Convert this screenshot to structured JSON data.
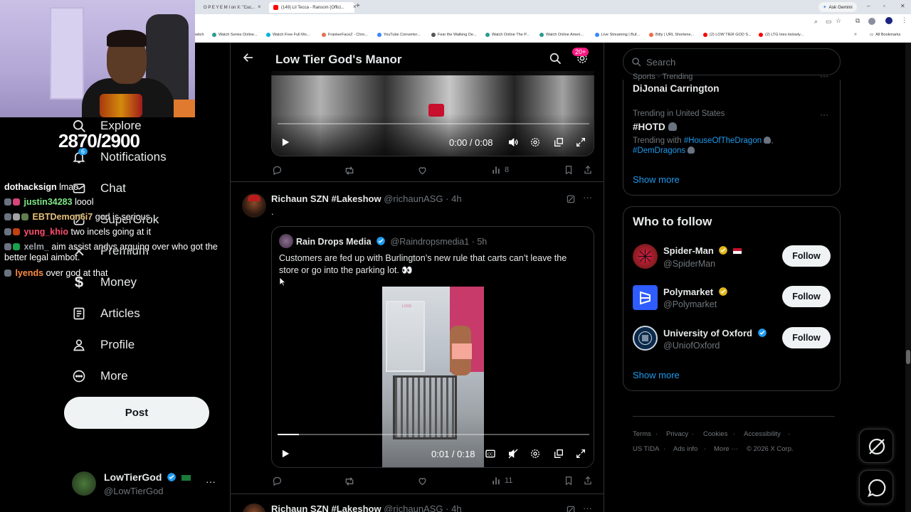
{
  "browser": {
    "tabs": [
      {
        "label": "(149) Lil Tecca - Ransom (Offici...",
        "favicon_color": "#ff0000"
      },
      {
        "label": "O P E Y E M I on X: \"Cuc...",
        "favicon_color": "#111111"
      }
    ],
    "ask_gemini": "Ask Gemini",
    "bookmarks": [
      "Watch Series Online...",
      "Watch Free Full Mo...",
      "FrankerFaceZ - Chro...",
      "YouTube Converter...",
      "Fear the Walking De...",
      "Watch Online The P...",
      "Watch Online Ameri...",
      "Live Streaming | Buf...",
      "Bitly | URL Shortene...",
      "(2) LOW TIER GOD S...",
      "(2) LTG tries itslowly..."
    ],
    "all_bookmarks": "All Bookmarks"
  },
  "stream": {
    "counter": "2870/2900",
    "chat": [
      {
        "user": "dothacksign",
        "user_color": "#ffffff",
        "message": "lmao"
      },
      {
        "user": "justin34283",
        "user_color": "#7ee787",
        "message": "loool"
      },
      {
        "user": "EBTDemon6i7",
        "user_color": "#e5c07b",
        "message": "god is serious"
      },
      {
        "user": "yung_khio",
        "user_color": "#ff4d6d",
        "message": "two incels going at it"
      },
      {
        "user": "xelm_",
        "user_color": "#9aa0a6",
        "message": "aim assist andys arguing over who got the better legal aimbot."
      },
      {
        "user": "lyends",
        "user_color": "#ff8c42",
        "message": "over god at that"
      }
    ]
  },
  "nav": {
    "items": [
      {
        "label": "Explore",
        "icon": "search-icon"
      },
      {
        "label": "Notifications",
        "icon": "bell-icon",
        "badge": "6"
      },
      {
        "label": "Chat",
        "icon": "envelope-icon"
      },
      {
        "label": "SuperGrok",
        "icon": "grok-icon"
      },
      {
        "label": "Premium",
        "icon": "x-icon"
      },
      {
        "label": "Money",
        "icon": "dollar-icon"
      },
      {
        "label": "Articles",
        "icon": "article-icon"
      },
      {
        "label": "Profile",
        "icon": "person-icon"
      },
      {
        "label": "More",
        "icon": "more-circle-icon"
      }
    ],
    "post_label": "Post",
    "account": {
      "name": "LowTierGod",
      "handle": "@LowTierGod"
    }
  },
  "main": {
    "title": "Low Tier God's Manor",
    "notif_badge": "20+",
    "first_video": {
      "time": "0:00 / 0:08",
      "views": "8"
    },
    "tweet": {
      "author": "Richaun SZN #Lakeshow",
      "handle": "@richaunASG",
      "time": "4h",
      "text": ".",
      "quoted": {
        "author": "Rain Drops Media",
        "handle": "@Raindropsmedia1",
        "time": "5h",
        "text": "Customers are fed up with Burlington’s new rule that carts can’t leave the store or go into the parking lot. 👀",
        "video_time": "0:01 / 0:18",
        "store_sign": "LOVE"
      },
      "views": "11"
    },
    "next_tweet": {
      "author": "Richaun SZN #Lakeshow",
      "handle": "@richaunASG",
      "time": "4h"
    }
  },
  "right": {
    "search_placeholder": "Search",
    "trends": [
      {
        "context": "Sports · Trending",
        "name": "DiJonai Carrington"
      },
      {
        "context": "Trending in United States",
        "name": "#HOTD",
        "trending_with_label": "Trending with",
        "trending_with": [
          "#HouseOfTheDragon",
          "#DemDragons"
        ]
      }
    ],
    "show_more": "Show more",
    "who_to_follow_title": "Who to follow",
    "follow_suggestions": [
      {
        "name": "Spider-Man",
        "handle": "@SpiderMan",
        "avatar_color": "#c8102e",
        "follow_label": "Follow"
      },
      {
        "name": "Polymarket",
        "handle": "@Polymarket",
        "avatar_color": "#2e5cff",
        "follow_label": "Follow"
      },
      {
        "name": "University of Oxford",
        "handle": "@UniofOxford",
        "avatar_color": "#0b2a4a",
        "follow_label": "Follow"
      }
    ],
    "footer": [
      "Terms",
      "Privacy",
      "Cookies",
      "Accessibility",
      "US TIDA",
      "Ads info",
      "More ···",
      "© 2026 X Corp."
    ]
  },
  "colors": {
    "accent": "#1d9bf0",
    "pink": "#f91880",
    "border": "#2f3336",
    "muted": "#71767b"
  }
}
